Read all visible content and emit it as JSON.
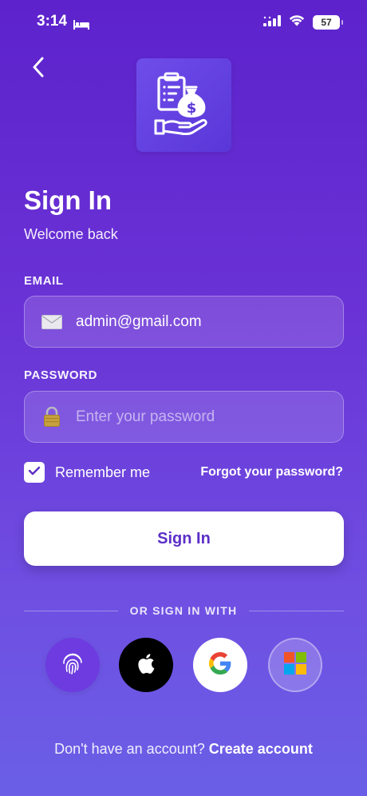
{
  "status_bar": {
    "time": "3:14",
    "battery": "57"
  },
  "header": {
    "title": "Sign In",
    "subtitle": "Welcome back"
  },
  "email": {
    "label": "EMAIL",
    "value": "admin@gmail.com"
  },
  "password": {
    "label": "PASSWORD",
    "placeholder": "Enter your password"
  },
  "options": {
    "remember_label": "Remember me",
    "remember_checked": true,
    "forgot_label": "Forgot your password?"
  },
  "actions": {
    "signin_label": "Sign In"
  },
  "social": {
    "divider_label": "OR SIGN IN WITH",
    "providers": [
      "fingerprint",
      "apple",
      "google",
      "microsoft"
    ]
  },
  "footer": {
    "prompt": "Don't have an account?",
    "link": "Create account"
  },
  "colors": {
    "primary": "#5b2fc8",
    "background_top": "#5d22cc",
    "background_bottom": "#6a5fe6"
  }
}
